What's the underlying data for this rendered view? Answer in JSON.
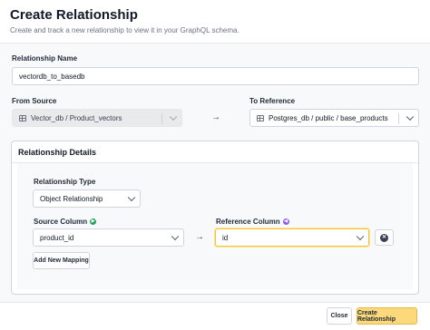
{
  "modal": {
    "title": "Create Relationship",
    "subtitle": "Create and track a new relationship to view it in your GraphQL schema."
  },
  "form": {
    "relationship_name_label": "Relationship Name",
    "relationship_name_value": "vectordb_to_basedb",
    "from_source_label": "From Source",
    "from_source_value": "Vector_db / Product_vectors",
    "to_reference_label": "To Reference",
    "to_reference_value": "Postgres_db / public / base_products",
    "arrow_glyph": "→"
  },
  "details": {
    "title": "Relationship Details",
    "relationship_type_label": "Relationship Type",
    "relationship_type_value": "Object Relationship",
    "source_column_label": "Source Column",
    "source_column_value": "product_id",
    "reference_column_label": "Reference Column",
    "reference_column_value": "id",
    "mapping_arrow": "→",
    "add_mapping_label": "Add New Mapping",
    "remove_glyph": "✕"
  },
  "footer": {
    "close_label": "Close",
    "create_label": "Create Relationship"
  },
  "colors": {
    "source_dot": "#22a35a",
    "reference_dot": "#8b5cf6",
    "primary_button": "#fcd97a",
    "focus_border": "#f3c14b"
  },
  "icons": {
    "table": "table-icon",
    "source_dot": "arrow-right-circle-icon",
    "reference_dot": "arrow-left-circle-icon",
    "remove": "close-circle-icon",
    "chevron": "chevron-down-icon"
  }
}
